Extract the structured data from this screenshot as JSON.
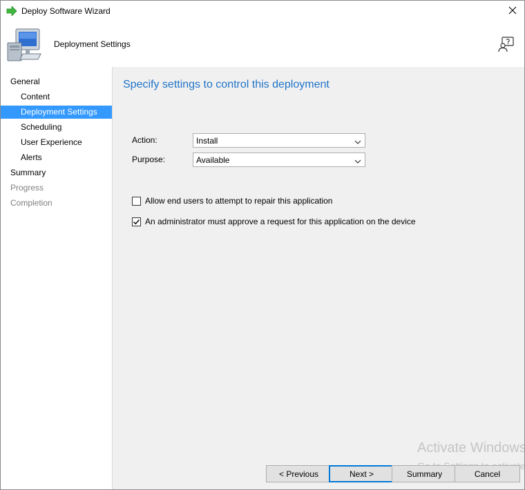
{
  "window": {
    "title": "Deploy Software Wizard",
    "icons": {
      "title": "green-arrow-icon",
      "close": "close-icon"
    }
  },
  "header": {
    "title": "Deployment Settings",
    "icons": {
      "page": "computer-icon",
      "help": "help-person-icon"
    }
  },
  "sidebar": {
    "items": [
      {
        "label": "General",
        "level": 1,
        "state": "normal"
      },
      {
        "label": "Content",
        "level": 2,
        "state": "normal"
      },
      {
        "label": "Deployment Settings",
        "level": 2,
        "state": "selected"
      },
      {
        "label": "Scheduling",
        "level": 2,
        "state": "normal"
      },
      {
        "label": "User Experience",
        "level": 2,
        "state": "normal"
      },
      {
        "label": "Alerts",
        "level": 2,
        "state": "normal"
      },
      {
        "label": "Summary",
        "level": 1,
        "state": "normal"
      },
      {
        "label": "Progress",
        "level": 1,
        "state": "disabled"
      },
      {
        "label": "Completion",
        "level": 1,
        "state": "disabled"
      }
    ]
  },
  "main": {
    "heading": "Specify settings to control this deployment",
    "action": {
      "label": "Action:",
      "value": "Install"
    },
    "purpose": {
      "label": "Purpose:",
      "value": "Available"
    },
    "checkboxes": [
      {
        "label": "Allow end users to attempt to repair this application",
        "checked": false
      },
      {
        "label": "An administrator must approve a request for this application on the device",
        "checked": true
      }
    ]
  },
  "buttons": {
    "previous": "< Previous",
    "next": "Next >",
    "summary": "Summary",
    "cancel": "Cancel"
  },
  "watermark": {
    "title": "Activate Windows",
    "subtitle": "Go to Settings to activate Windows."
  },
  "colors": {
    "selection": "#3399ff",
    "heading": "#1f73c8",
    "panel": "#f0f0f0",
    "default_button_border": "#0078d7"
  }
}
